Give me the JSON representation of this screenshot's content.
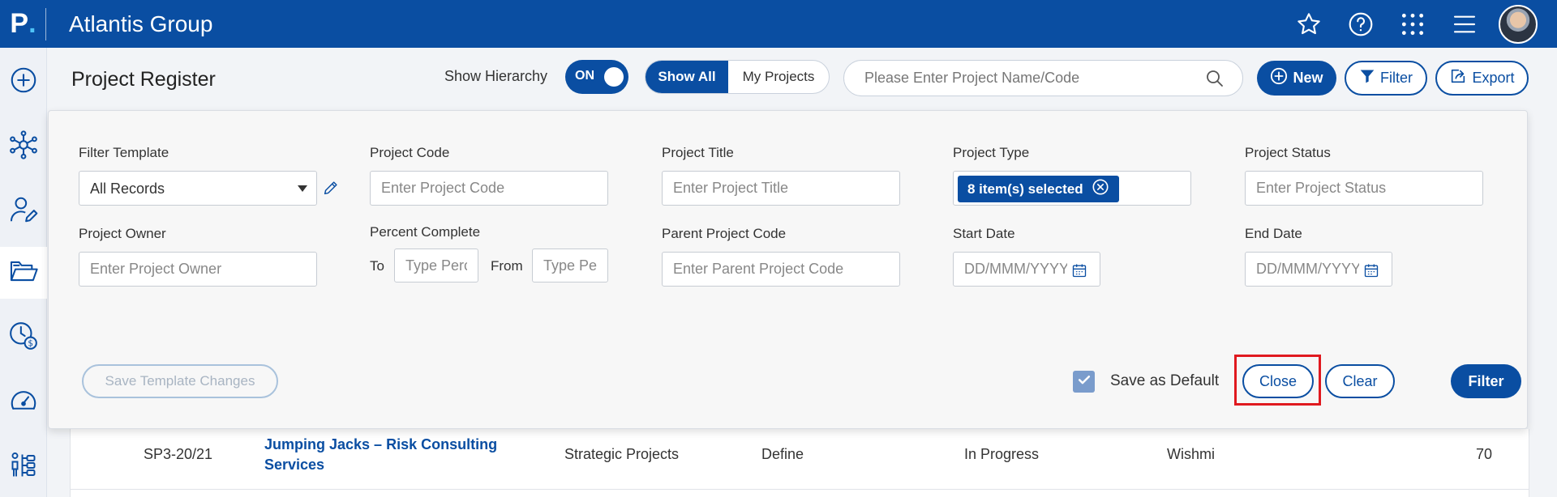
{
  "app": {
    "logo_letter": "P",
    "logo_dot": ".",
    "title": "Atlantis Group"
  },
  "topbar_icons": [
    "star-icon",
    "help-icon",
    "apps-grid-icon",
    "menu-icon"
  ],
  "sidebar": {
    "items": [
      "add-icon",
      "network-icon",
      "user-edit-icon",
      "folder-icon",
      "time-billing-icon",
      "dashboard-gauge-icon",
      "org-chart-icon"
    ],
    "active_index": 3
  },
  "header": {
    "page_title": "Project Register",
    "show_hierarchy_label": "Show Hierarchy",
    "toggle_text": "ON",
    "show_all": "Show All",
    "my_projects": "My Projects",
    "search_placeholder": "Please Enter Project Name/Code",
    "new_label": "New",
    "filter_label": "Filter",
    "export_label": "Export"
  },
  "filter": {
    "filter_template": {
      "label": "Filter Template",
      "value": "All Records"
    },
    "project_code": {
      "label": "Project Code",
      "placeholder": "Enter Project Code"
    },
    "project_title": {
      "label": "Project Title",
      "placeholder": "Enter Project Title"
    },
    "project_type": {
      "label": "Project Type",
      "chip": "8 item(s) selected"
    },
    "project_status": {
      "label": "Project Status",
      "placeholder": "Enter Project Status"
    },
    "project_owner": {
      "label": "Project Owner",
      "placeholder": "Enter Project Owner"
    },
    "percent_complete": {
      "label": "Percent Complete",
      "to_label": "To",
      "to_placeholder": "Type Perc",
      "from_label": "From",
      "from_placeholder": "Type Pe"
    },
    "parent_project_code": {
      "label": "Parent Project Code",
      "placeholder": "Enter Parent Project Code"
    },
    "start_date": {
      "label": "Start Date",
      "placeholder": "DD/MMM/YYYY"
    },
    "end_date": {
      "label": "End Date",
      "placeholder": "DD/MMM/YYYY"
    },
    "save_template_label": "Save Template Changes",
    "save_default_label": "Save as Default",
    "save_default_checked": true,
    "close_label": "Close",
    "clear_label": "Clear",
    "filter_label": "Filter"
  },
  "table_row": {
    "code": "SP3-20/21",
    "title_line1": "Jumping Jacks – Risk Consulting",
    "title_line2": "Services",
    "type": "Strategic Projects",
    "phase": "Define",
    "status": "In Progress",
    "owner": "Wishmi",
    "percent": "70"
  },
  "colors": {
    "primary": "#0a4ea2",
    "highlight": "#e0191f"
  }
}
